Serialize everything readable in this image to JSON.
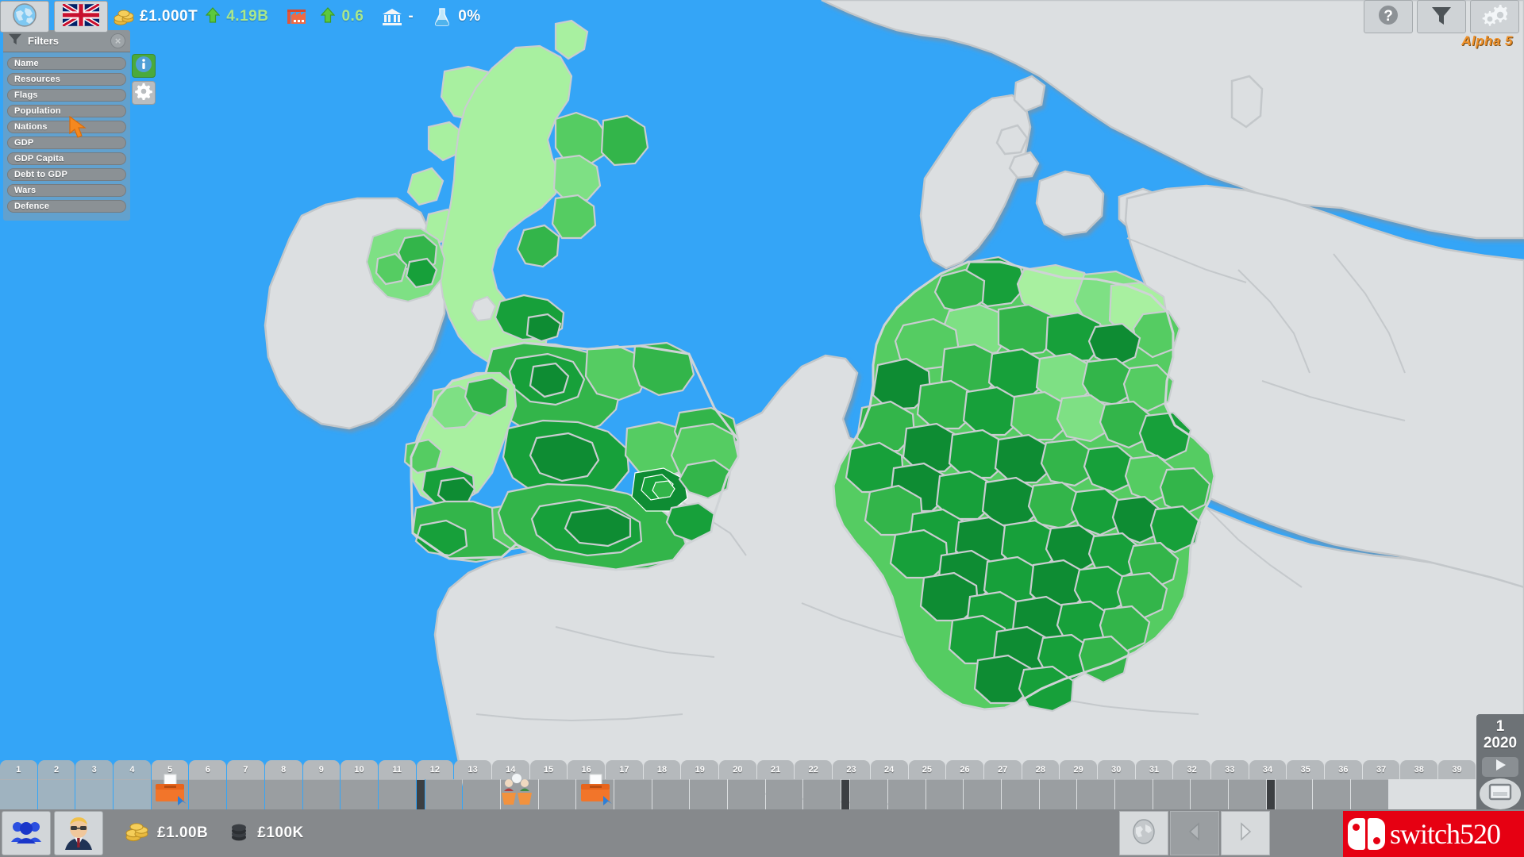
{
  "app": {
    "version_label": "Alpha 5",
    "sea_color": "#34a5f7",
    "neutral_land_color": "#dddddd",
    "highlight_greens": [
      "#a8f0a0",
      "#7ee084",
      "#56cc63",
      "#33b54a",
      "#17a03a",
      "#0e8c33"
    ]
  },
  "top_bar": {
    "buttons": [
      {
        "name": "globe-button",
        "icon": "globe-icon"
      },
      {
        "name": "nation-flag-button",
        "icon": "uk-flag-icon"
      }
    ],
    "stats": [
      {
        "id": "treasury",
        "icon": "coins-icon",
        "value": "£1.000T",
        "delta": "4.19B",
        "trend": "up"
      },
      {
        "id": "industry",
        "icon": "factory-icon",
        "value": "",
        "delta": "0.6",
        "trend": "up"
      },
      {
        "id": "government",
        "icon": "bank-icon",
        "value": "-",
        "delta": "",
        "trend": "none"
      },
      {
        "id": "research",
        "icon": "flask-icon",
        "value": "0%",
        "delta": "",
        "trend": "none"
      }
    ],
    "right_buttons": [
      {
        "name": "help-button",
        "icon": "question-mark-icon"
      },
      {
        "name": "filters-button",
        "icon": "funnel-icon"
      },
      {
        "name": "settings-button",
        "icon": "gears-icon"
      }
    ]
  },
  "filters_panel": {
    "title": "Filters",
    "icon": "funnel-icon",
    "close_label": "×",
    "items": [
      {
        "label": "Name"
      },
      {
        "label": "Resources"
      },
      {
        "label": "Flags"
      },
      {
        "label": "Population"
      },
      {
        "label": "Nations"
      },
      {
        "label": "GDP"
      },
      {
        "label": "GDP Capita"
      },
      {
        "label": "Debt to GDP"
      },
      {
        "label": "Wars"
      },
      {
        "label": "Defence"
      }
    ]
  },
  "side_buttons": [
    {
      "name": "info-button",
      "icon": "info-icon",
      "style": "info"
    },
    {
      "name": "map-settings-button",
      "icon": "gear-icon",
      "style": "gear"
    }
  ],
  "timeline": {
    "ticks": [
      1,
      2,
      3,
      4,
      5,
      6,
      7,
      8,
      9,
      10,
      11,
      12,
      13,
      14,
      15,
      16,
      17,
      18,
      19,
      20,
      21,
      22,
      23,
      24,
      25,
      26,
      27,
      28,
      29,
      30,
      31,
      32,
      33,
      34,
      35,
      36,
      37,
      38,
      39
    ],
    "past_until": 4,
    "quarter_marks": [
      12,
      24,
      36
    ],
    "events": [
      {
        "slot": 5,
        "icon": "ballot-box-icon"
      },
      {
        "slot": 15,
        "icon": "debate-icon"
      },
      {
        "slot": 17,
        "icon": "ballot-box-icon"
      }
    ]
  },
  "date_panel": {
    "month": "1",
    "year": "2020",
    "play_icon": "play-icon",
    "speed_icon": "speed-dial-icon"
  },
  "status_bar": {
    "buttons": [
      {
        "name": "population-button",
        "icon": "people-icon"
      },
      {
        "name": "leader-button",
        "icon": "politician-avatar-icon"
      }
    ],
    "stats": [
      {
        "id": "party-funds",
        "icon": "gold-coins-icon",
        "value": "£1.00B"
      },
      {
        "id": "personal-funds",
        "icon": "dark-coins-icon",
        "value": "£100K"
      }
    ],
    "nav": [
      {
        "name": "world-view-button",
        "icon": "globe-small-icon",
        "dim": false
      },
      {
        "name": "previous-button",
        "icon": "left-arrow-icon",
        "dim": true
      },
      {
        "name": "next-button",
        "icon": "right-arrow-icon",
        "dim": false
      }
    ]
  },
  "watermark": {
    "text": "switch520",
    "brand_color": "#e60012"
  }
}
